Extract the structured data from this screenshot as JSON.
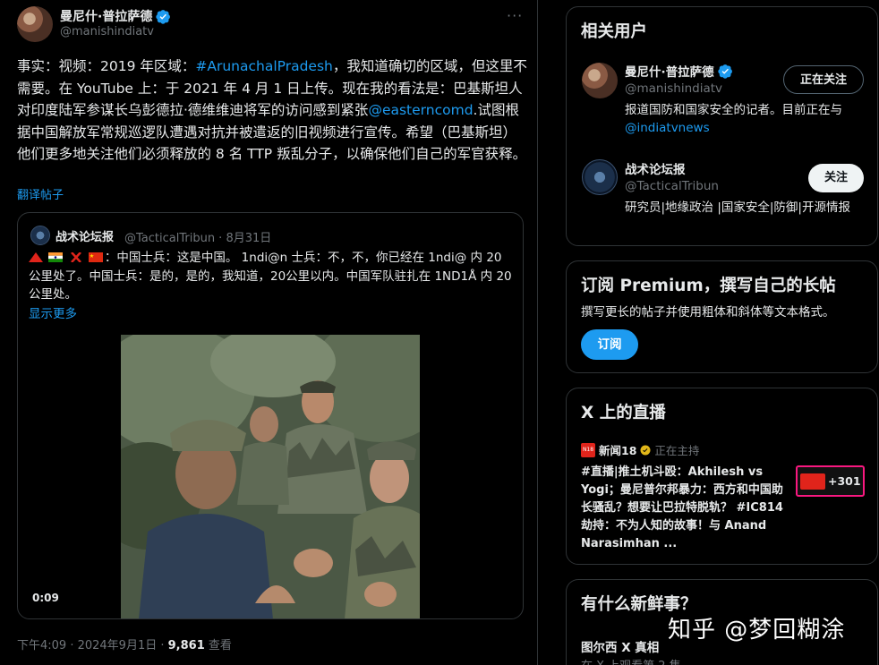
{
  "tweet": {
    "author_name": "曼尼什·普拉萨德",
    "author_handle": "@manishindiatv",
    "more_label": "···",
    "text_part1": "事实：视频：2019 年区域：",
    "hashtag": "#ArunachalPradesh",
    "text_part2": "，我知道确切的区域，但这里不需要。在 YouTube 上：于 2021 年 4 月 1 日上传。现在我的看法是：巴基斯坦人对印度陆军参谋长乌彭德拉·德维维迪将军的访问感到紧张",
    "mention": "@easterncomd",
    "text_part3": ".试图根据中国解放军常规巡逻队遭遇对抗并被遣返的旧视频进行宣传。希望（巴基斯坦）他们更多地关注他们必须释放的 8 名 TTP 叛乱分子，以确保他们自己的军官获释。",
    "translate_label": "翻译帖子",
    "timestamp": "下午4:09 · 2024年9月1日 · ",
    "views_count": "9,861",
    "views_label": " 查看"
  },
  "quote": {
    "author_name": "战术论坛报",
    "author_handle_date": "@TacticalTribun · 8月31日",
    "text_line1": "：中国士兵：这是中国。 1ndi@n 士兵：不，不，你已经在 1ndi@ 内 20 公里处了。中国士兵：是的，是的，我知道，20公里以内。中国军队驻扎在 1ND1Å 内 20 公里处。",
    "show_more": "显示更多",
    "video_duration": "0:09"
  },
  "sidebar": {
    "related_users": {
      "title": "相关用户",
      "users": [
        {
          "name": "曼尼什·普拉萨德",
          "handle": "@manishindiatv",
          "bio_text": "报道国防和国家安全的记者。目前正在与",
          "bio_link": "@indiatvnews",
          "button_label": "正在关注"
        },
        {
          "name": "战术论坛报",
          "handle": "@TacticalTribun",
          "bio_text": "研究员|地缘政治 |国家安全|防御|开源情报",
          "button_label": "关注"
        }
      ]
    },
    "premium": {
      "title": "订阅 Premium，撰写自己的长帖",
      "description": "撰写更长的帖子并使用粗体和斜体等文本格式。",
      "button_label": "订阅"
    },
    "live": {
      "title": "X 上的直播",
      "channel": "新闻18",
      "status": "正在主持",
      "headline": "#直播|推土机斗殴：Akhilesh vs Yogi；曼尼普尔邦暴力：西方和中国助长骚乱？想要让巴拉特脱轨？ #IC814 劫持：不为人知的故事！与 Anand Narasimhan ...",
      "listener_count": "+301"
    },
    "whats_new": {
      "title": "有什么新鲜事？",
      "item_title": "图尔西 X 真相",
      "item_sub": "在 X 上观看第 2 集"
    }
  },
  "watermark": "知乎 @梦回糊涂",
  "colors": {
    "accent": "#1d9bf0",
    "background": "#000000",
    "border": "#2f3336",
    "secondary_text": "#71767b",
    "live_ring": "#f91880"
  }
}
